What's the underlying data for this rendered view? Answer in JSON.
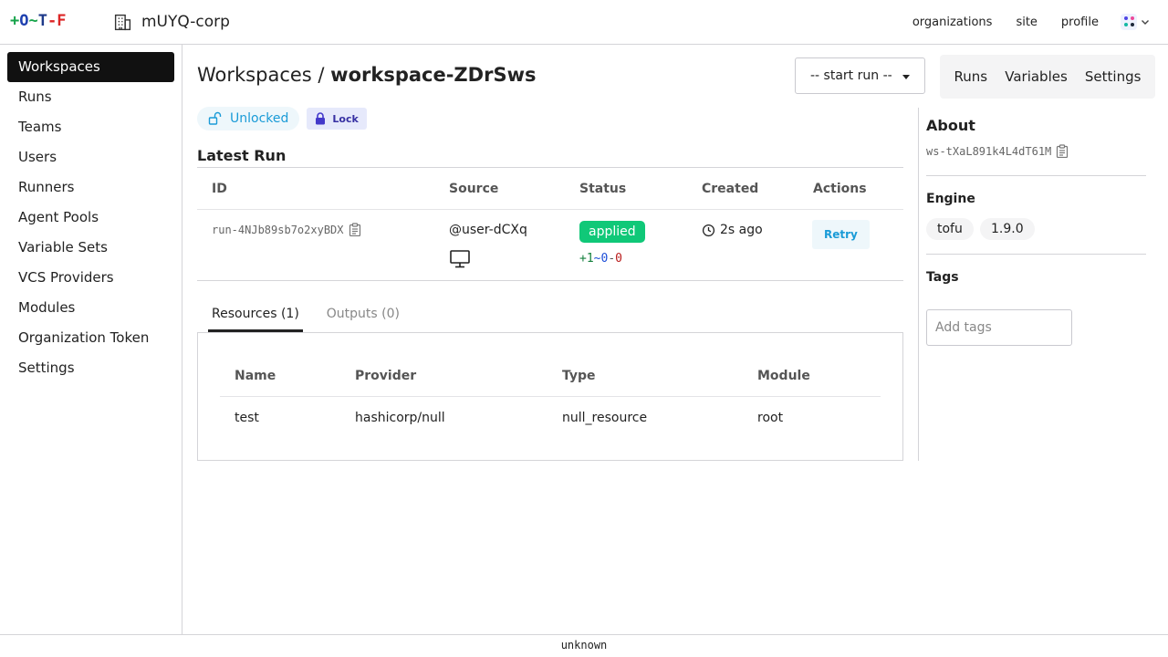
{
  "logo": {
    "plus": "+",
    "o": "O",
    "tilde": "~",
    "t": "T",
    "dash": "-",
    "f": "F"
  },
  "header": {
    "org_name": "mUYQ-corp",
    "nav": [
      "organizations",
      "site",
      "profile"
    ]
  },
  "sidebar": {
    "items": [
      {
        "label": "Workspaces",
        "active": true
      },
      {
        "label": "Runs"
      },
      {
        "label": "Teams"
      },
      {
        "label": "Users"
      },
      {
        "label": "Runners"
      },
      {
        "label": "Agent Pools"
      },
      {
        "label": "Variable Sets"
      },
      {
        "label": "VCS Providers"
      },
      {
        "label": "Modules"
      },
      {
        "label": "Organization Token"
      },
      {
        "label": "Settings"
      }
    ]
  },
  "page": {
    "breadcrumb_parent": "Workspaces",
    "separator": " / ",
    "workspace_name": "workspace-ZDrSws",
    "start_run_label": "-- start run --",
    "ws_nav": [
      "Runs",
      "Variables",
      "Settings"
    ],
    "lock_status": "Unlocked",
    "lock_button": "Lock"
  },
  "latest_run": {
    "heading": "Latest Run",
    "columns": [
      "ID",
      "Source",
      "Status",
      "Created",
      "Actions"
    ],
    "run_id": "run-4NJb89sb7o2xyBDX",
    "source_user": "@user-dCXq",
    "status": "applied",
    "diff": {
      "add": "+1",
      "change": "~0",
      "sep": "-",
      "destroy": "0"
    },
    "created": "2s ago",
    "action": "Retry"
  },
  "tabs": [
    {
      "label": "Resources (1)",
      "active": true
    },
    {
      "label": "Outputs (0)",
      "active": false
    }
  ],
  "resources": {
    "columns": [
      "Name",
      "Provider",
      "Type",
      "Module"
    ],
    "rows": [
      [
        "test",
        "hashicorp/null",
        "null_resource",
        "root"
      ]
    ]
  },
  "about": {
    "heading": "About",
    "workspace_id": "ws-tXaL891k4L4dT61M",
    "engine_heading": "Engine",
    "engine": "tofu",
    "engine_version": "1.9.0",
    "tags_heading": "Tags",
    "tags_placeholder": "Add tags"
  },
  "footer": {
    "text": "unknown"
  },
  "colors": {
    "status_applied": "#10c878",
    "accent": "#1a9bd7",
    "active_nav": "#111111"
  }
}
